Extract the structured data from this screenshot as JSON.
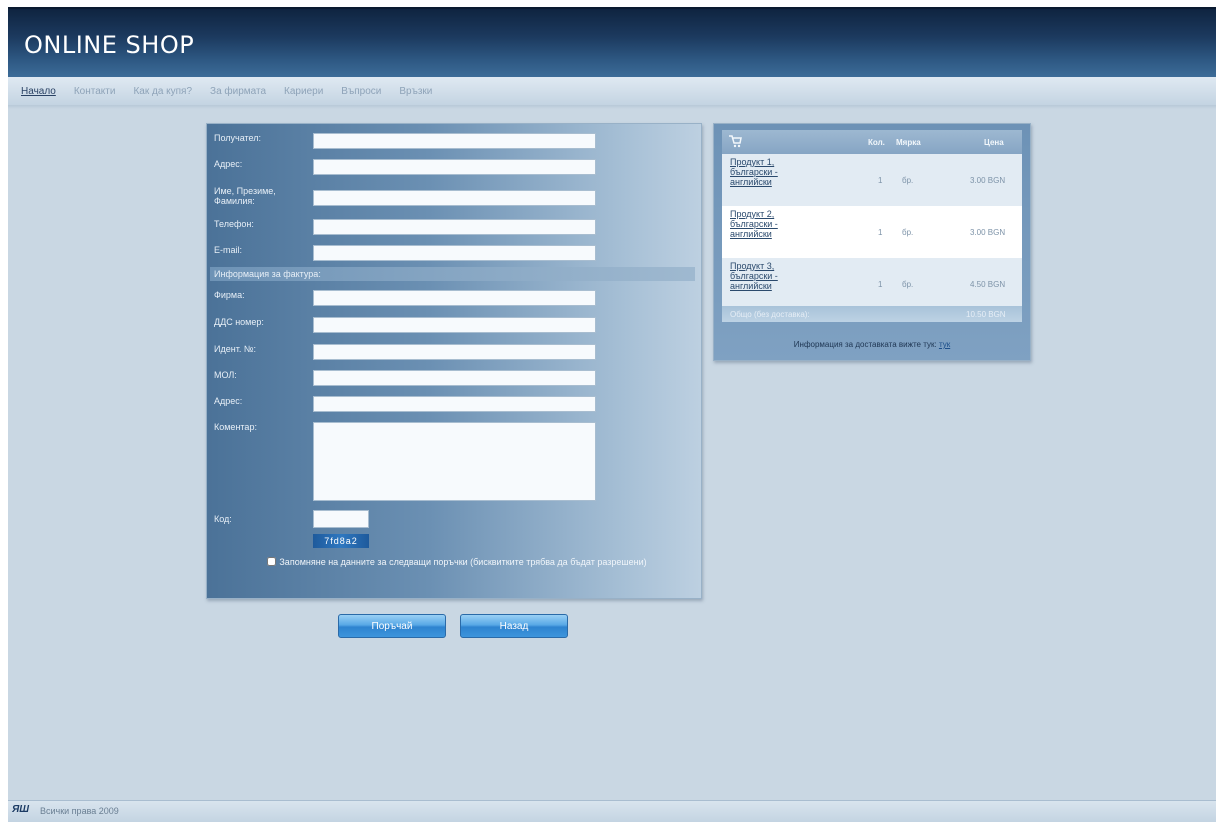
{
  "header": {
    "logo": "ONLINE SHOP"
  },
  "nav": {
    "items": [
      "Начало",
      "Контакти",
      "Как да купя?",
      "За фирмата",
      "Кариери",
      "Въпроси",
      "Връзки"
    ]
  },
  "form": {
    "recipient_label": "Получател:",
    "address_label": "Адрес:",
    "full_name_label": "Име, Презиме, Фамилия:",
    "phone_label": "Телефон:",
    "email_label": "E-mail:",
    "invoice_section": "Информация за фактура:",
    "company_label": "Фирма:",
    "vat_label": "ДДС номер:",
    "id_label": "Идент. №:",
    "mol_label": "МОЛ:",
    "invoice_address_label": "Адрес:",
    "comment_label": "Коментар:",
    "code_label": "Код:",
    "captcha_text": "7fd8a2",
    "remember_text": "Запомняне на данните за следващи поръчки (бисквитките трябва да бъдат разрешени)",
    "order_button": "Поръчай",
    "back_button": "Назад"
  },
  "cart": {
    "headers": {
      "qty": "Кол.",
      "unit": "Мярка",
      "price": "Цена"
    },
    "rows": [
      {
        "name": "Продукт 1, български - английски",
        "qty": "1",
        "unit": "бр.",
        "price": "3.00 BGN"
      },
      {
        "name": "Продукт 2, български - английски",
        "qty": "1",
        "unit": "бр.",
        "price": "3.00 BGN"
      },
      {
        "name": "Продукт 3, български - английски",
        "qty": "1",
        "unit": "бр.",
        "price": "4.50 BGN"
      }
    ],
    "total_label": "Общо (без доставка):",
    "total_value": "10.50 BGN",
    "delivery_note": "Информация за доставката вижте тук:",
    "delivery_link": "тук"
  },
  "footer": {
    "logo": "ЯШ",
    "text": "Всички права 2009"
  }
}
